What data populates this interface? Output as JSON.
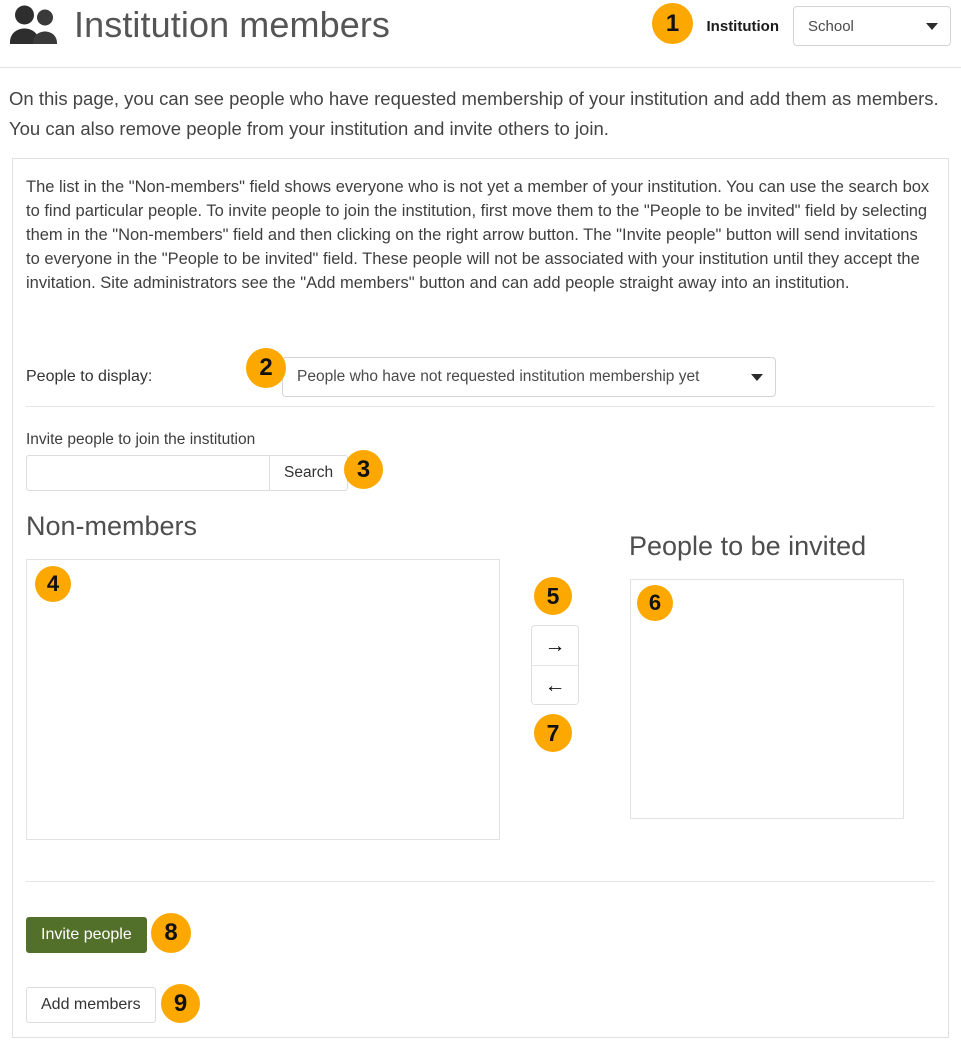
{
  "header": {
    "icon": "users-icon",
    "title": "Institution members",
    "institution_label": "Institution",
    "institution_select_value": "School"
  },
  "intro": "On this page, you can see people who have requested membership of your institution and add them as members. You can also remove people from your institution and invite others to join.",
  "panel": {
    "help_text": "The list in the \"Non-members\" field shows everyone who is not yet a member of your institution. You can use the search box to find particular people. To invite people to join the institution, first move them to the \"People to be invited\" field by selecting them in the \"Non-members\" field and then clicking on the right arrow button. The \"Invite people\" button will send invitations to everyone in the \"People to be invited\" field. These people will not be associated with your institution until they accept the invitation. Site administrators see the \"Add members\" button and can add people straight away into an institution.",
    "display_label": "People to display:",
    "display_select_value": "People who have not requested institution membership yet",
    "search_label": "Invite people to join the institution",
    "search_value": "",
    "search_placeholder": "",
    "search_button": "Search",
    "nonmembers_heading": "Non-members",
    "invited_heading": "People to be invited",
    "nonmembers_items": [],
    "invited_items": [],
    "arrow_right": "→",
    "arrow_left": "←",
    "invite_button": "Invite people",
    "add_members_button": "Add members"
  },
  "badges": {
    "b1": "1",
    "b2": "2",
    "b3": "3",
    "b4": "4",
    "b5": "5",
    "b6": "6",
    "b7": "7",
    "b8": "8",
    "b9": "9"
  },
  "colors": {
    "badge_background": "#fca800",
    "primary_button": "#53702b",
    "border": "#e0e0e0"
  }
}
